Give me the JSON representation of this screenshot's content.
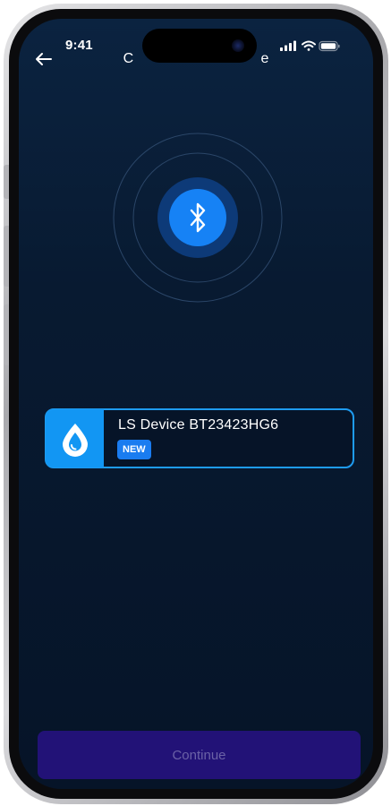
{
  "status_bar": {
    "time": "9:41",
    "icons": [
      "cellular-signal-icon",
      "wifi-icon",
      "battery-icon"
    ]
  },
  "header": {
    "back_icon": "arrow-left-icon",
    "title": "C                                e"
  },
  "scanner": {
    "icon": "bluetooth-icon",
    "colors": {
      "center": "#1682f5",
      "halo": "#0d3a78",
      "rings": "#2b4668"
    }
  },
  "device_list": [
    {
      "icon": "water-drop-icon",
      "name": "LS Device BT23423HG6",
      "badge": "NEW",
      "selected": true
    }
  ],
  "footer": {
    "continue_label": "Continue",
    "continue_enabled": false
  },
  "colors": {
    "background": "#081a31",
    "accent": "#1e9bf0",
    "button_disabled_bg": "#221277",
    "button_disabled_text": "#6b62a6"
  }
}
